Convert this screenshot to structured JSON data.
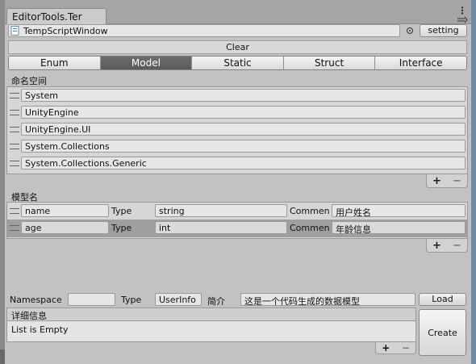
{
  "window": {
    "tab_title": "EditorTools.Ter",
    "menu_icon": "kebab-menu-icon",
    "maximize_icon": "maximize-icon"
  },
  "toolbar": {
    "script_field": "TempScriptWindow",
    "setting_label": "setting",
    "clear_label": "Clear"
  },
  "modes": {
    "tabs": [
      "Enum",
      "Model",
      "Static",
      "Struct",
      "Interface"
    ],
    "active": "Model"
  },
  "namespaces": {
    "title": "命名空间",
    "items": [
      "System",
      "UnityEngine",
      "UnityEngine.UI",
      "System.Collections",
      "System.Collections.Generic"
    ],
    "add_label": "+",
    "remove_label": "−"
  },
  "model": {
    "title": "模型名",
    "type_label": "Type",
    "comment_label": "Commen",
    "fields": [
      {
        "name": "name",
        "type": "string",
        "comment": "用户姓名"
      },
      {
        "name": "age",
        "type": "int",
        "comment": "年龄信息"
      }
    ],
    "selected_index": 1,
    "add_label": "+",
    "remove_label": "−"
  },
  "footer": {
    "namespace_label": "Namespace",
    "namespace_value": "",
    "type_label": "Type",
    "type_value": "UserInfo",
    "intro_label": "简介",
    "intro_value": "这是一个代码生成的数据模型",
    "load_label": "Load",
    "details_title": "详细信息",
    "details_text": "List is Empty",
    "create_label": "Create",
    "add_label": "+",
    "remove_label": "−"
  },
  "colors": {
    "window_bg": "#c2c2c2",
    "active_tab": "#5f5f5f",
    "selected_row": "#9f9f9f"
  }
}
